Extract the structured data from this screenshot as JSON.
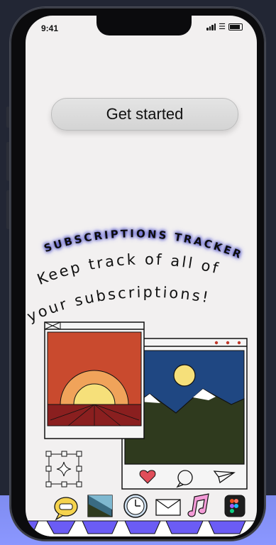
{
  "status_bar": {
    "time": "9:41"
  },
  "cta": {
    "label": "Get started"
  },
  "hero": {
    "title": "SUBSCRIPTIONS TRACKER",
    "tagline_line1": "Keep track of all of",
    "tagline_line2": "your subscriptions!"
  },
  "colors": {
    "background": "#222634",
    "screen": "#f2f0f0",
    "accent_purple": "#6b5cf5",
    "title_glow": "#6b6df0"
  },
  "dock": {
    "icons": [
      "chat-bubble-icon",
      "photo-icon",
      "clock-icon",
      "mail-icon",
      "music-note-icon",
      "figma-icon"
    ]
  }
}
